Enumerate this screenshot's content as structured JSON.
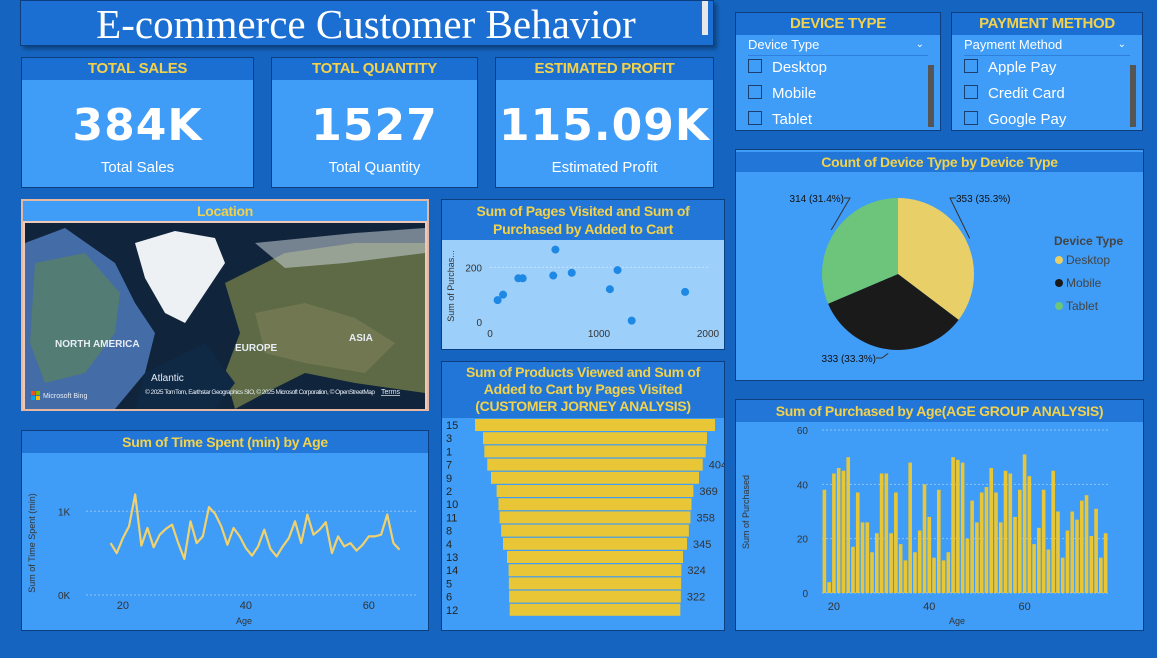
{
  "title": "E-commerce Customer Behavior",
  "kpis": [
    {
      "label": "TOTAL SALES",
      "value": "384K",
      "caption": "Total Sales"
    },
    {
      "label": "TOTAL QUANTITY",
      "value": "1527",
      "caption": "Total Quantity"
    },
    {
      "label": "ESTIMATED PROFIT",
      "value": "115.09K",
      "caption": "Estimated Profit"
    }
  ],
  "slicers": {
    "device": {
      "title": "DEVICE TYPE",
      "header": "Device Type",
      "options": [
        "Desktop",
        "Mobile",
        "Tablet"
      ]
    },
    "payment": {
      "title": "PAYMENT METHOD",
      "header": "Payment Method",
      "options": [
        "Apple Pay",
        "Credit Card",
        "Google Pay"
      ]
    }
  },
  "map": {
    "title": "Location",
    "labels": {
      "na": "NORTH AMERICA",
      "eu": "EUROPE",
      "asia": "ASIA",
      "atl": "Atlantic"
    },
    "credits": "© 2025 TomTom, Earthstar Geographics SIO, © 2025 Microsoft Corporation, © OpenStreetMap",
    "terms": "Terms",
    "bing": "Microsoft Bing"
  },
  "colors": {
    "background": "#1565c0",
    "panel": "#3f9cf7",
    "title": "#f2d24c",
    "bar": "#e8c635",
    "line": "#f1d26c",
    "dot": "#1e88e5"
  },
  "chart_data": [
    {
      "id": "pie",
      "type": "pie",
      "title": "Count of Device Type by Device Type",
      "legend_title": "Device Type",
      "slices": [
        {
          "label": "Desktop",
          "value": 353,
          "text": "353 (35.3%)",
          "color": "#e8cf67"
        },
        {
          "label": "Mobile",
          "value": 333,
          "text": "333 (33.3%)",
          "color": "#1a1a1a"
        },
        {
          "label": "Tablet",
          "value": 314,
          "text": "314 (31.4%)",
          "color": "#6cc57a"
        }
      ]
    },
    {
      "id": "scatter",
      "type": "scatter",
      "title": "Sum of Pages Visited and Sum of Purchased by Added to Cart",
      "ylabel": "Sum of Purchas...",
      "xlim": [
        0,
        2000
      ],
      "ylim": [
        0,
        300
      ],
      "xticks": [
        "0",
        "1000",
        "2000"
      ],
      "yticks": [
        "0",
        "200"
      ],
      "points": [
        [
          70,
          80
        ],
        [
          120,
          100
        ],
        [
          260,
          160
        ],
        [
          300,
          160
        ],
        [
          580,
          170
        ],
        [
          600,
          265
        ],
        [
          750,
          180
        ],
        [
          1100,
          120
        ],
        [
          1170,
          190
        ],
        [
          1300,
          5
        ],
        [
          1790,
          110
        ]
      ]
    },
    {
      "id": "funnel",
      "type": "bar",
      "title": "Sum of Products Viewed and Sum of Added to Cart by Pages Visited (CUSTOMER JORNEY ANALYSIS)",
      "categories": [
        "15",
        "3",
        "1",
        "7",
        "9",
        "2",
        "10",
        "11",
        "8",
        "4",
        "13",
        "14",
        "5",
        "6",
        "12"
      ],
      "values": [
        450,
        420,
        415,
        404,
        390,
        369,
        362,
        358,
        352,
        345,
        330,
        324,
        323,
        322,
        320
      ],
      "labels": {
        "3": "404",
        "5": "369",
        "7": "358",
        "9": "345",
        "11": "324",
        "13": "322"
      }
    },
    {
      "id": "line",
      "type": "line",
      "title": "Sum of Time Spent (min) by Age",
      "xlabel": "Age",
      "ylabel": "Sum of Time Spent (min)",
      "xlim": [
        14,
        68
      ],
      "ylim": [
        0,
        1600
      ],
      "yticks": [
        "0K",
        "1K"
      ],
      "xticks": [
        "20",
        "40",
        "60"
      ],
      "x": [
        18,
        19,
        20,
        21,
        22,
        23,
        24,
        25,
        26,
        27,
        28,
        29,
        30,
        31,
        32,
        33,
        34,
        35,
        36,
        37,
        38,
        39,
        40,
        41,
        42,
        43,
        44,
        45,
        46,
        47,
        48,
        49,
        50,
        51,
        52,
        53,
        54,
        55,
        56,
        57,
        58,
        59,
        60,
        61,
        62,
        63,
        64,
        65
      ],
      "y": [
        620,
        500,
        680,
        820,
        1200,
        590,
        800,
        570,
        720,
        790,
        840,
        620,
        430,
        880,
        620,
        700,
        1050,
        970,
        820,
        600,
        800,
        700,
        560,
        470,
        580,
        780,
        550,
        460,
        580,
        680,
        880,
        620,
        960,
        720,
        780,
        870,
        500,
        700,
        580,
        620,
        530,
        600,
        700,
        700,
        720,
        960,
        620,
        540
      ]
    },
    {
      "id": "bars",
      "type": "bar",
      "title": "Sum of Purchased by Age(AGE GROUP ANALYSIS)",
      "xlabel": "Age",
      "ylabel": "Sum of Purchased",
      "ylim": [
        0,
        60
      ],
      "yticks": [
        "0",
        "20",
        "40",
        "60"
      ],
      "xticks": [
        "20",
        "40",
        "60"
      ],
      "x_start": 18,
      "values": [
        38,
        4,
        44,
        46,
        45,
        50,
        17,
        37,
        26,
        26,
        15,
        22,
        44,
        44,
        22,
        37,
        18,
        12,
        48,
        15,
        23,
        40,
        28,
        13,
        38,
        12,
        15,
        50,
        49,
        48,
        20,
        34,
        26,
        37,
        39,
        46,
        37,
        26,
        45,
        44,
        28,
        38,
        51,
        43,
        18,
        24,
        38,
        16,
        45,
        30,
        13,
        23,
        30,
        27,
        34,
        36,
        21,
        31,
        13,
        22
      ]
    }
  ]
}
